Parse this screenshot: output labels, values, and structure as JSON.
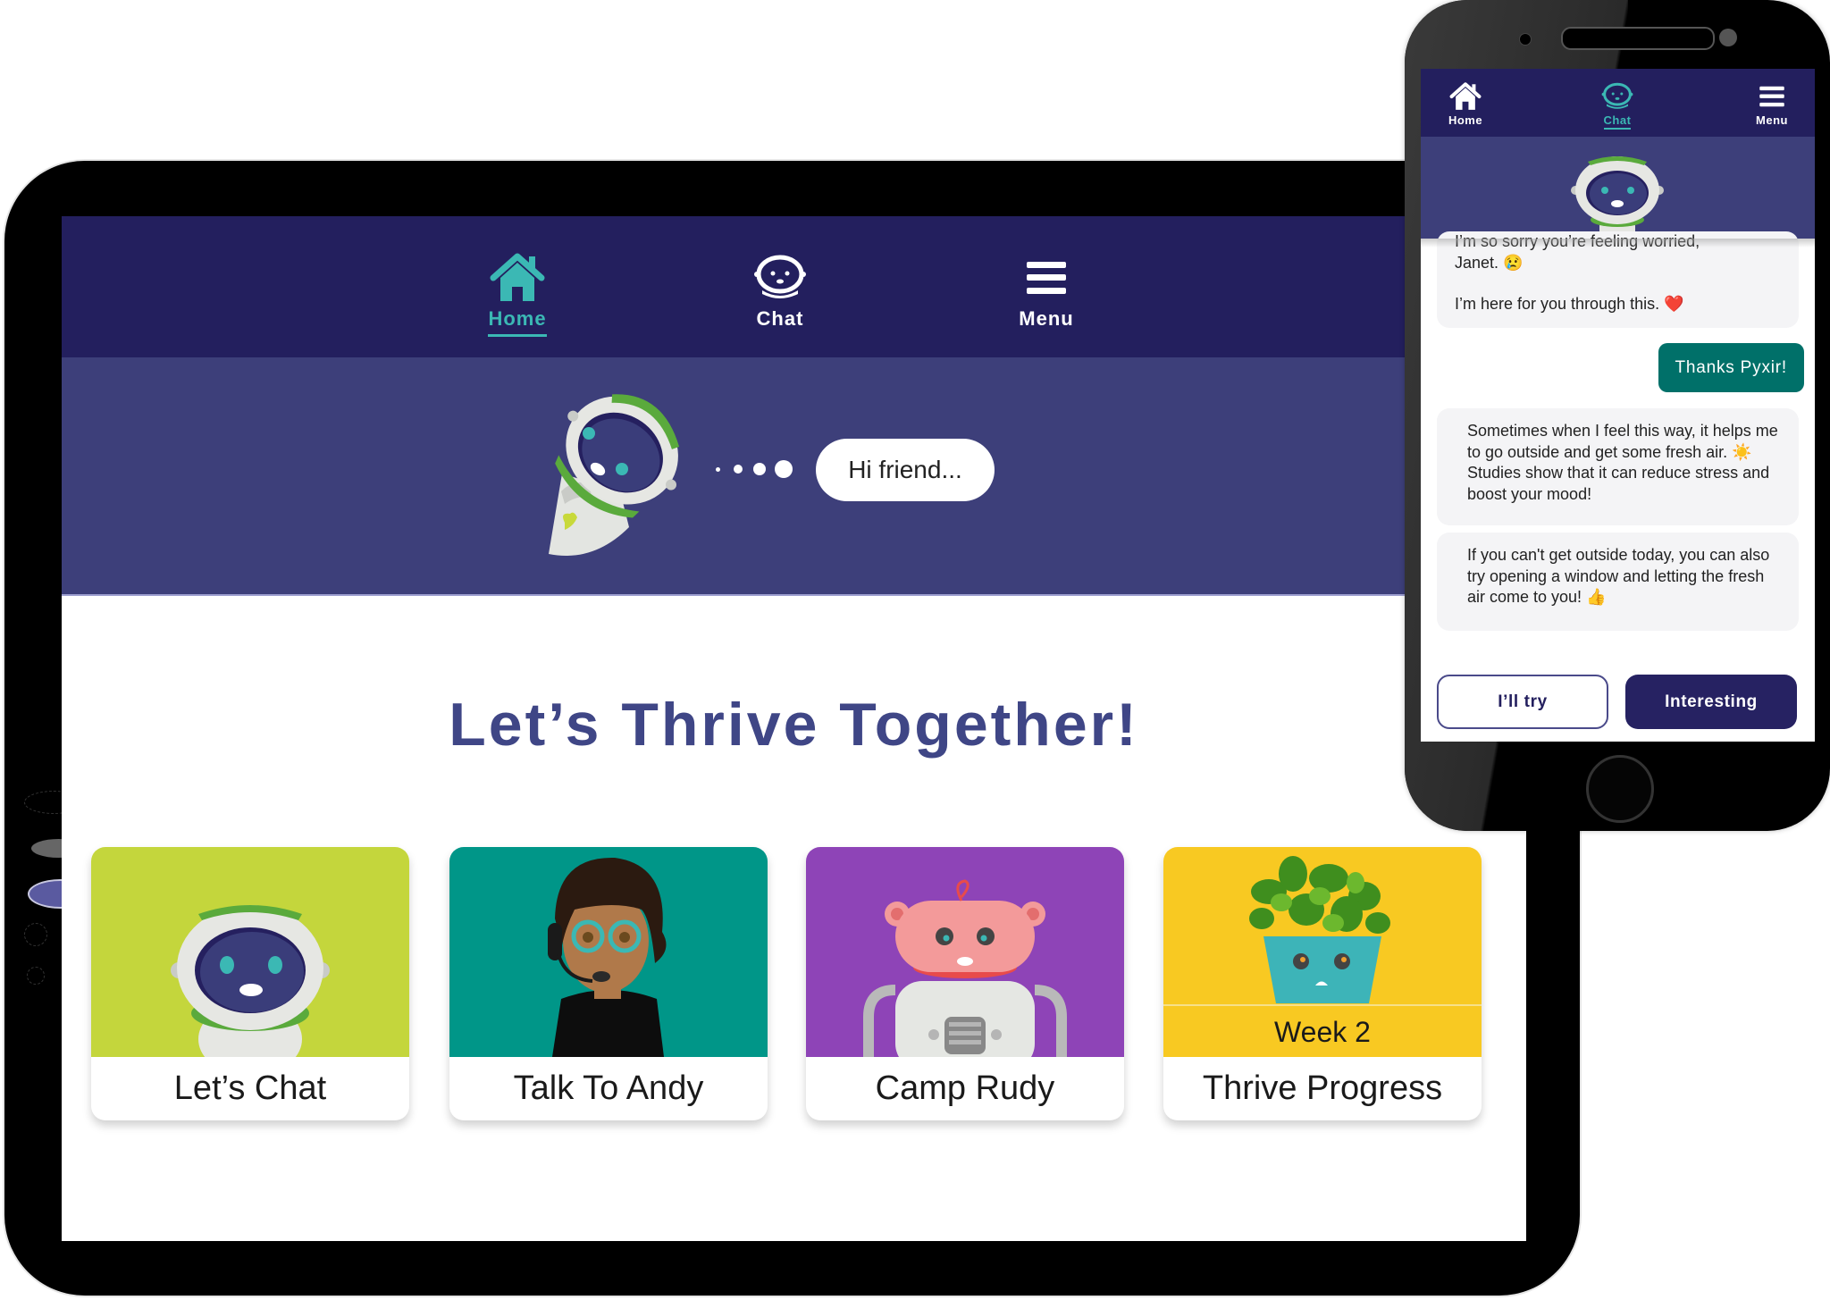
{
  "tablet": {
    "nav": {
      "items": [
        {
          "label": "Home",
          "icon": "home-icon",
          "active": true
        },
        {
          "label": "Chat",
          "icon": "robot-chat-icon",
          "active": false
        },
        {
          "label": "Menu",
          "icon": "hamburger-menu-icon",
          "active": false
        }
      ]
    },
    "hero": {
      "greeting": "Hi friend..."
    },
    "title": "Let’s Thrive Together!",
    "cards": [
      {
        "label": "Let’s Chat",
        "image": "pyxir-robot",
        "color": "#c4d63c"
      },
      {
        "label": "Talk To Andy",
        "image": "andy-avatar-headset",
        "color": "#009688"
      },
      {
        "label": "Camp Rudy",
        "image": "rudy-bear-robot",
        "color": "#8e44b7"
      },
      {
        "label": "Thrive Progress",
        "image": "smiling-plant-pot",
        "color": "#f8c922",
        "sublabel": "Week 2"
      }
    ]
  },
  "phone": {
    "nav": {
      "items": [
        {
          "label": "Home",
          "icon": "home-icon",
          "active": false
        },
        {
          "label": "Chat",
          "icon": "robot-chat-icon",
          "active": true
        },
        {
          "label": "Menu",
          "icon": "hamburger-menu-icon",
          "active": false
        }
      ]
    },
    "messages": [
      {
        "from": "bot",
        "lines": [
          "I’m so sorry you’re feeling worried,",
          "Janet. 😢",
          "I’m here for you through this. ❤️"
        ]
      },
      {
        "from": "user",
        "text": "Thanks Pyxir!"
      },
      {
        "from": "bot",
        "text": "Sometimes when I feel this way, it helps me to go outside and get some fresh air. ☀️ Studies show that it can reduce stress and boost your mood!"
      },
      {
        "from": "bot",
        "text": "If you can't get outside today, you can also try opening a window and letting the fresh air come to you! 👍"
      }
    ],
    "quick_replies": [
      "I’ll try",
      "Interesting"
    ]
  },
  "colors": {
    "nav_bg": "#231f5e",
    "hero_bg": "#3d3f7a",
    "accent_teal": "#3bb8b4",
    "title": "#3f4686",
    "user_bubble": "#007069",
    "primary_button": "#262262"
  }
}
